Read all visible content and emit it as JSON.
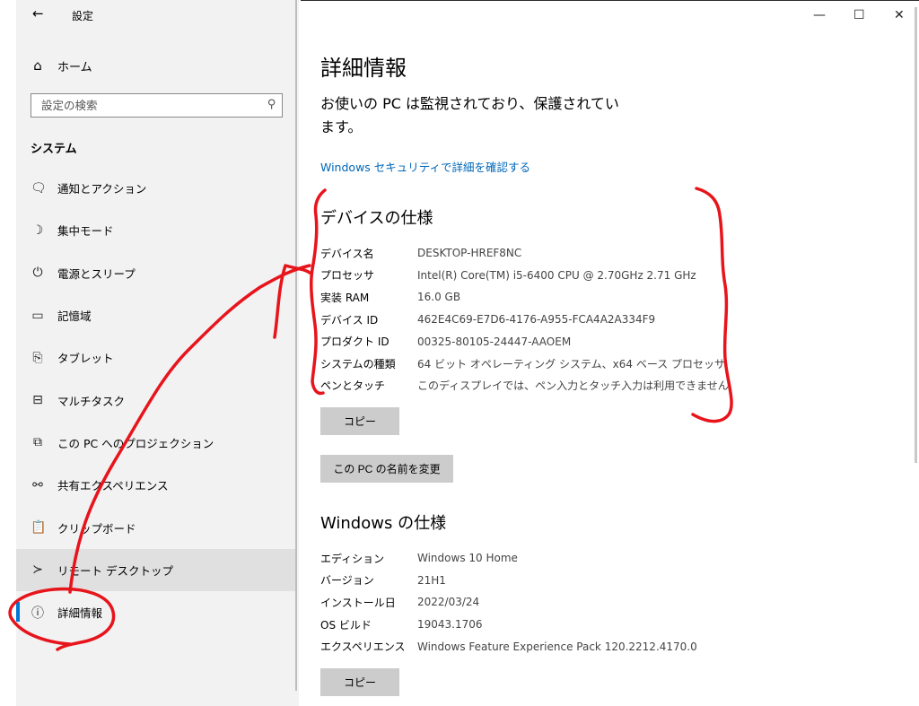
{
  "app": {
    "title": "設定",
    "back_icon": "arrow-left-icon"
  },
  "window_controls": {
    "minimize": "—",
    "maximize": "☐",
    "close": "✕"
  },
  "sidebar": {
    "home_label": "ホーム",
    "search_placeholder": "設定の検索",
    "section_title": "システム",
    "items": [
      {
        "icon": "message-icon",
        "glyph": "🗨",
        "label": "通知とアクション"
      },
      {
        "icon": "moon-icon",
        "glyph": "☽",
        "label": "集中モード"
      },
      {
        "icon": "power-icon",
        "glyph": "⏻",
        "label": "電源とスリープ"
      },
      {
        "icon": "storage-icon",
        "glyph": "▭",
        "label": "記憶域"
      },
      {
        "icon": "tablet-icon",
        "glyph": "⎘",
        "label": "タブレット"
      },
      {
        "icon": "multitask-icon",
        "glyph": "⊟",
        "label": "マルチタスク"
      },
      {
        "icon": "project-icon",
        "glyph": "⧉",
        "label": "この PC へのプロジェクション"
      },
      {
        "icon": "shared-icon",
        "glyph": "⚯",
        "label": "共有エクスペリエンス"
      },
      {
        "icon": "clipboard-icon",
        "glyph": "📋",
        "label": "クリップボード"
      },
      {
        "icon": "remote-icon",
        "glyph": "≻",
        "label": "リモート デスクトップ"
      },
      {
        "icon": "info-icon",
        "glyph": "ⓘ",
        "label": "詳細情報"
      }
    ],
    "selected_index": 10,
    "hover_index": 9
  },
  "main": {
    "title": "詳細情報",
    "protection_text": "お使いの PC は監視されており、保護されています。",
    "security_link": "Windows セキュリティで詳細を確認する",
    "device_specs": {
      "heading": "デバイスの仕様",
      "rows": [
        {
          "key": "デバイス名",
          "value": "DESKTOP-HREF8NC"
        },
        {
          "key": "プロセッサ",
          "value": "Intel(R) Core(TM) i5-6400 CPU @ 2.70GHz   2.71 GHz"
        },
        {
          "key": "実装 RAM",
          "value": "16.0 GB"
        },
        {
          "key": "デバイス ID",
          "value": "462E4C69-E7D6-4176-A955-FCA4A2A334F9"
        },
        {
          "key": "プロダクト ID",
          "value": "00325-80105-24447-AAOEM"
        },
        {
          "key": "システムの種類",
          "value": "64 ビット オペレーティング システム、x64 ベース プロセッサ"
        },
        {
          "key": "ペンとタッチ",
          "value": "このディスプレイでは、ペン入力とタッチ入力は利用できません"
        }
      ],
      "copy_button": "コピー",
      "rename_button": "この PC の名前を変更"
    },
    "windows_specs": {
      "heading": "Windows の仕様",
      "rows": [
        {
          "key": "エディション",
          "value": "Windows 10 Home"
        },
        {
          "key": "バージョン",
          "value": "21H1"
        },
        {
          "key": "インストール日",
          "value": "2022/03/24"
        },
        {
          "key": "OS ビルド",
          "value": "19043.1706"
        },
        {
          "key": "エクスペリエンス",
          "value": "Windows Feature Experience Pack 120.2212.4170.0"
        }
      ],
      "copy_button": "コピー"
    }
  },
  "annotation_color": "#e8141c"
}
